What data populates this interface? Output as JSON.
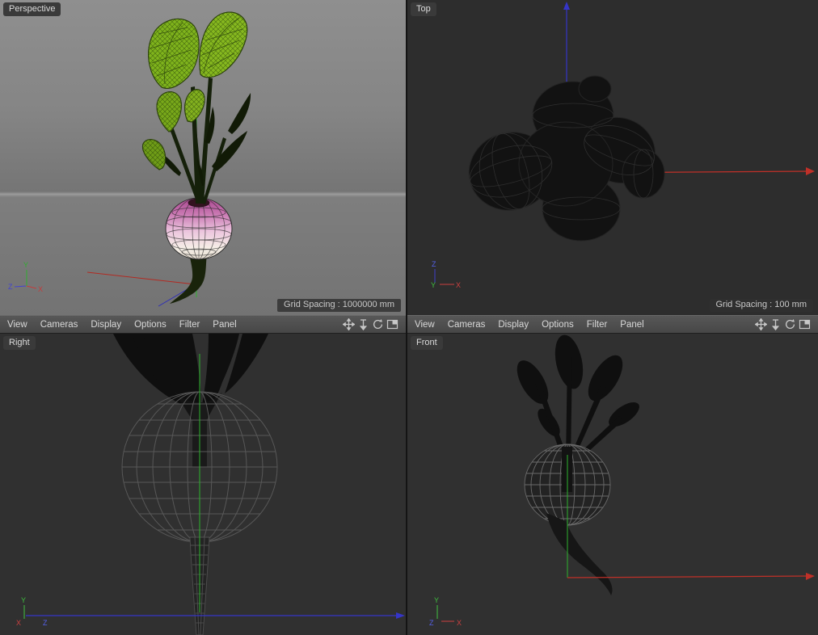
{
  "menu": {
    "items": [
      "View",
      "Cameras",
      "Display",
      "Options",
      "Filter",
      "Panel"
    ],
    "icons": {
      "pan": "pan-camera-icon",
      "dolly": "dolly-camera-icon",
      "rotate": "rotate-camera-icon",
      "toggle": "toggle-view-icon"
    }
  },
  "viewports": {
    "perspective": {
      "label": "Perspective",
      "grid_spacing": "Grid Spacing : 1000000 mm",
      "axis_y": "Y",
      "axis_z": "Z",
      "axis_x": "X"
    },
    "top": {
      "label": "Top",
      "grid_spacing": "Grid Spacing : 100 mm",
      "axis_y": "Y",
      "axis_z": "Z",
      "axis_x": "X"
    },
    "right": {
      "label": "Right",
      "axis_y": "Y",
      "axis_z": "Z",
      "axis_x": "X"
    },
    "front": {
      "label": "Front",
      "axis_y": "Y",
      "axis_z": "Z",
      "axis_x": "X"
    }
  },
  "colors": {
    "axis_x": "#c43c3c",
    "axis_y": "#38bf38",
    "axis_z": "#4343cc",
    "leaf_green": "#83b41e",
    "bulb_pink": "#c2569f"
  }
}
